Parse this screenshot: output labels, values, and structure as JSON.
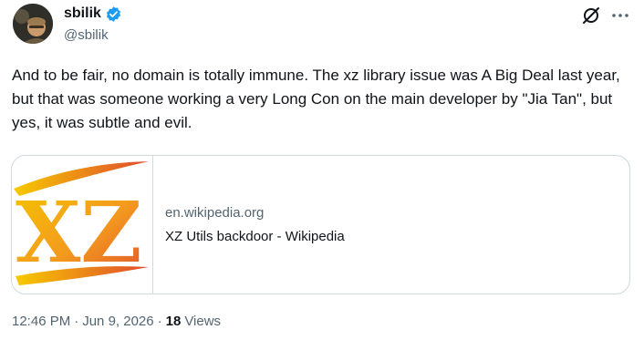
{
  "author": {
    "display_name": "sbilik",
    "handle": "@sbilik",
    "verified": true
  },
  "tweet": {
    "text": "And to be fair, no domain is totally immune. The xz library issue was A Big Deal last year, but that was someone working a very Long Con on the main developer by \"Jia Tan\", but yes, it was subtle and evil."
  },
  "link_card": {
    "domain": "en.wikipedia.org",
    "title": "XZ Utils backdoor - Wikipedia",
    "thumbnail_text": "XZ"
  },
  "meta": {
    "time": "12:46 PM",
    "separator": "·",
    "date": "Jun 9, 2026",
    "separator2": "·",
    "views_count": "18",
    "views_label": "Views"
  },
  "icons": {
    "verified": "verified-badge-icon",
    "grok": "grok-icon",
    "more": "more-options-icon"
  },
  "colors": {
    "verified_blue": "#1d9bf0",
    "text_primary": "#0f1419",
    "text_secondary": "#536471",
    "border": "#cfd9de"
  }
}
